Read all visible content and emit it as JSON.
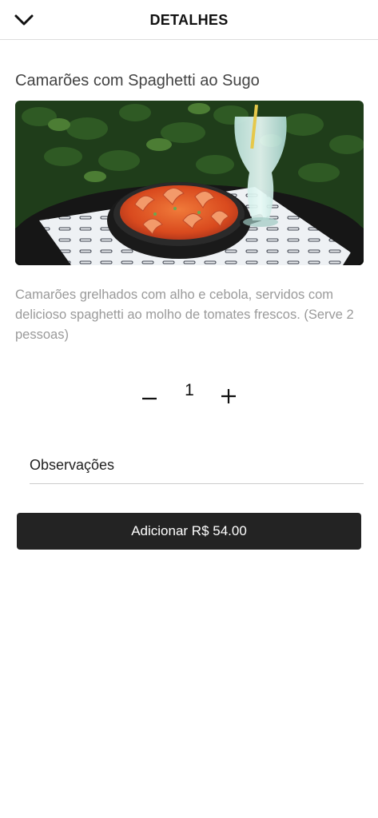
{
  "header": {
    "title": "DETALHES",
    "back_icon": "chevron-down-icon"
  },
  "dish": {
    "title": "Camarões com Spaghetti ao Sugo",
    "image_icon": "dish-photo",
    "description": "Camarões grelhados com alho e cebola, servidos com delicioso spaghetti ao molho de tomates frescos. (Serve 2 pessoas)"
  },
  "quantity": {
    "value": "1",
    "minus_icon": "minus-icon",
    "plus_icon": "plus-icon"
  },
  "notes": {
    "placeholder": "Observações",
    "value": ""
  },
  "add_button": {
    "label": "Adicionar R$ 54.00"
  },
  "colors": {
    "button_bg": "#232323",
    "description_text": "#9a9a9a",
    "divider": "#dddddd"
  }
}
